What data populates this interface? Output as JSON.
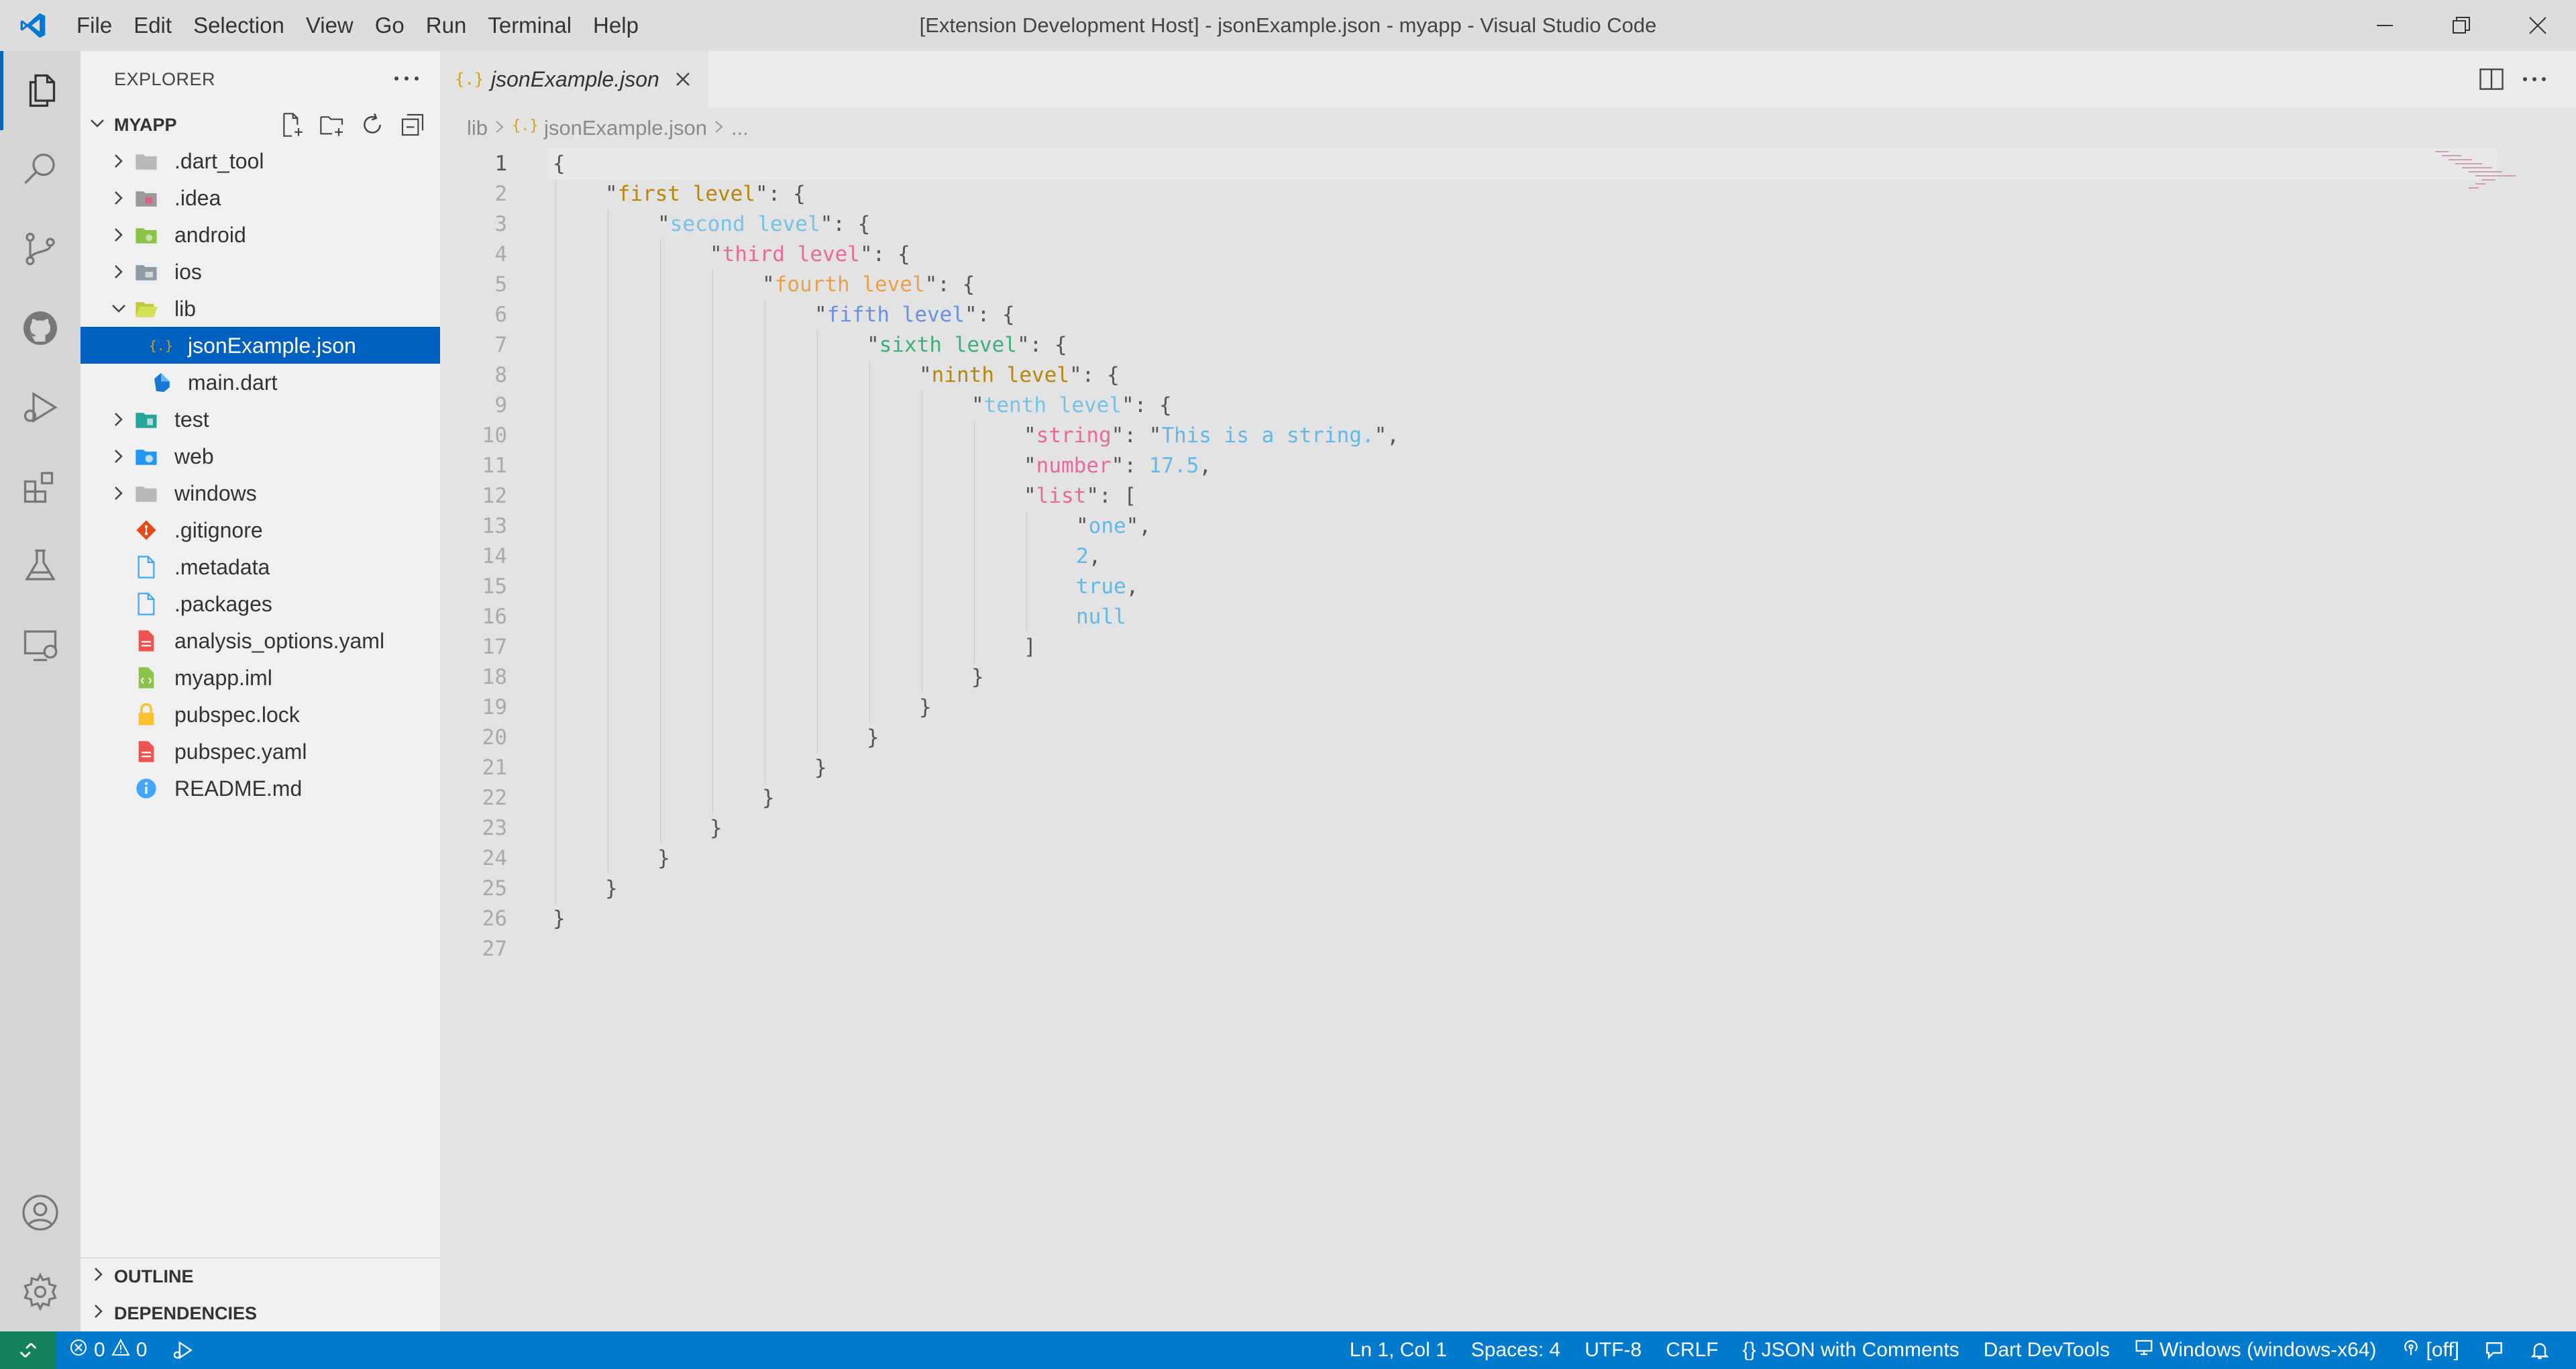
{
  "window": {
    "title": "[Extension Development Host] - jsonExample.json - myapp - Visual Studio Code"
  },
  "menu": [
    "File",
    "Edit",
    "Selection",
    "View",
    "Go",
    "Run",
    "Terminal",
    "Help"
  ],
  "activity_bar": {
    "items": [
      "explorer-icon",
      "search-icon",
      "source-control-icon",
      "github-icon",
      "run-debug-icon",
      "extensions-icon",
      "testing-icon",
      "remote-explorer-icon"
    ],
    "bottom": [
      "account-icon",
      "settings-gear-icon"
    ]
  },
  "sidebar": {
    "title": "EXPLORER",
    "root": "MYAPP",
    "tree": [
      {
        "label": ".dart_tool",
        "type": "folder",
        "icon": "folder-icon"
      },
      {
        "label": ".idea",
        "type": "folder",
        "icon": "idea-folder-icon"
      },
      {
        "label": "android",
        "type": "folder",
        "icon": "android-folder-icon"
      },
      {
        "label": "ios",
        "type": "folder",
        "icon": "ios-folder-icon"
      },
      {
        "label": "lib",
        "type": "folder-open",
        "icon": "lib-folder-icon"
      },
      {
        "label": "jsonExample.json",
        "type": "file",
        "icon": "json-file-icon",
        "selected": true
      },
      {
        "label": "main.dart",
        "type": "file",
        "icon": "dart-file-icon"
      },
      {
        "label": "test",
        "type": "folder",
        "icon": "test-folder-icon"
      },
      {
        "label": "web",
        "type": "folder",
        "icon": "web-folder-icon"
      },
      {
        "label": "windows",
        "type": "folder",
        "icon": "folder-icon"
      },
      {
        "label": ".gitignore",
        "type": "file",
        "icon": "git-file-icon"
      },
      {
        "label": ".metadata",
        "type": "file",
        "icon": "file-icon"
      },
      {
        "label": ".packages",
        "type": "file",
        "icon": "file-icon"
      },
      {
        "label": "analysis_options.yaml",
        "type": "file",
        "icon": "yaml-file-icon"
      },
      {
        "label": "myapp.iml",
        "type": "file",
        "icon": "iml-file-icon"
      },
      {
        "label": "pubspec.lock",
        "type": "file",
        "icon": "lock-file-icon"
      },
      {
        "label": "pubspec.yaml",
        "type": "file",
        "icon": "yaml-file-icon"
      },
      {
        "label": "README.md",
        "type": "file",
        "icon": "info-file-icon"
      }
    ],
    "sections": [
      "OUTLINE",
      "DEPENDENCIES"
    ]
  },
  "editor": {
    "tab_label": "jsonExample.json",
    "breadcrumb": [
      "lib",
      "jsonExample.json",
      "..."
    ],
    "colors": {
      "punct": "#555555",
      "l1": "#b8860b",
      "l2": "#74c3e6",
      "l3": "#e66b9b",
      "l4": "#e8a14a",
      "l5": "#6c8fe0",
      "l6": "#3fae7a",
      "l7": "#b8860b",
      "l8": "#74c3e6",
      "key9": "#e66b9b",
      "value": "#62b8e6"
    },
    "lines": [
      {
        "n": "1",
        "depth": 0,
        "parts": [
          [
            "{",
            "punct"
          ]
        ]
      },
      {
        "n": "2",
        "depth": 1,
        "parts": [
          [
            "\"",
            "punct"
          ],
          [
            "first level",
            "l1"
          ],
          [
            "\": {",
            "punct"
          ]
        ]
      },
      {
        "n": "3",
        "depth": 2,
        "parts": [
          [
            "\"",
            "punct"
          ],
          [
            "second level",
            "l2"
          ],
          [
            "\": {",
            "punct"
          ]
        ]
      },
      {
        "n": "4",
        "depth": 3,
        "parts": [
          [
            "\"",
            "punct"
          ],
          [
            "third level",
            "l3"
          ],
          [
            "\": {",
            "punct"
          ]
        ]
      },
      {
        "n": "5",
        "depth": 4,
        "parts": [
          [
            "\"",
            "punct"
          ],
          [
            "fourth level",
            "l4"
          ],
          [
            "\": {",
            "punct"
          ]
        ]
      },
      {
        "n": "6",
        "depth": 5,
        "parts": [
          [
            "\"",
            "punct"
          ],
          [
            "fifth level",
            "l5"
          ],
          [
            "\": {",
            "punct"
          ]
        ]
      },
      {
        "n": "7",
        "depth": 6,
        "parts": [
          [
            "\"",
            "punct"
          ],
          [
            "sixth level",
            "l6"
          ],
          [
            "\": {",
            "punct"
          ]
        ]
      },
      {
        "n": "8",
        "depth": 7,
        "parts": [
          [
            "\"",
            "punct"
          ],
          [
            "ninth level",
            "l7"
          ],
          [
            "\": {",
            "punct"
          ]
        ]
      },
      {
        "n": "9",
        "depth": 8,
        "parts": [
          [
            "\"",
            "punct"
          ],
          [
            "tenth level",
            "l8"
          ],
          [
            "\": {",
            "punct"
          ]
        ]
      },
      {
        "n": "10",
        "depth": 9,
        "parts": [
          [
            "\"",
            "punct"
          ],
          [
            "string",
            "key9"
          ],
          [
            "\": \"",
            "punct"
          ],
          [
            "This is a string.",
            "value"
          ],
          [
            "\",",
            "punct"
          ]
        ]
      },
      {
        "n": "11",
        "depth": 9,
        "parts": [
          [
            "\"",
            "punct"
          ],
          [
            "number",
            "key9"
          ],
          [
            "\": ",
            "punct"
          ],
          [
            "17.5",
            "value"
          ],
          [
            ",",
            "punct"
          ]
        ]
      },
      {
        "n": "12",
        "depth": 9,
        "parts": [
          [
            "\"",
            "punct"
          ],
          [
            "list",
            "key9"
          ],
          [
            "\": [",
            "punct"
          ]
        ]
      },
      {
        "n": "13",
        "depth": 10,
        "parts": [
          [
            "\"",
            "punct"
          ],
          [
            "one",
            "value"
          ],
          [
            "\",",
            "punct"
          ]
        ]
      },
      {
        "n": "14",
        "depth": 10,
        "parts": [
          [
            "2",
            "value"
          ],
          [
            ",",
            "punct"
          ]
        ]
      },
      {
        "n": "15",
        "depth": 10,
        "parts": [
          [
            "true",
            "value"
          ],
          [
            ",",
            "punct"
          ]
        ]
      },
      {
        "n": "16",
        "depth": 10,
        "parts": [
          [
            "null",
            "value"
          ]
        ]
      },
      {
        "n": "17",
        "depth": 9,
        "parts": [
          [
            "]",
            "punct"
          ]
        ]
      },
      {
        "n": "18",
        "depth": 8,
        "parts": [
          [
            "}",
            "punct"
          ]
        ]
      },
      {
        "n": "19",
        "depth": 7,
        "parts": [
          [
            "}",
            "punct"
          ]
        ]
      },
      {
        "n": "20",
        "depth": 6,
        "parts": [
          [
            "}",
            "punct"
          ]
        ]
      },
      {
        "n": "21",
        "depth": 5,
        "parts": [
          [
            "}",
            "punct"
          ]
        ]
      },
      {
        "n": "22",
        "depth": 4,
        "parts": [
          [
            "}",
            "punct"
          ]
        ]
      },
      {
        "n": "23",
        "depth": 3,
        "parts": [
          [
            "}",
            "punct"
          ]
        ]
      },
      {
        "n": "24",
        "depth": 2,
        "parts": [
          [
            "}",
            "punct"
          ]
        ]
      },
      {
        "n": "25",
        "depth": 1,
        "parts": [
          [
            "}",
            "punct"
          ]
        ]
      },
      {
        "n": "26",
        "depth": 0,
        "parts": [
          [
            "}",
            "punct"
          ]
        ]
      },
      {
        "n": "27",
        "depth": 0,
        "parts": []
      }
    ]
  },
  "statusbar": {
    "errors": "0",
    "warnings": "0",
    "position": "Ln 1, Col 1",
    "spaces": "Spaces: 4",
    "encoding": "UTF-8",
    "eol": "CRLF",
    "language": "JSON with Comments",
    "devtools": "Dart DevTools",
    "device": "Windows (windows-x64)",
    "live": "[off]"
  },
  "theme": {
    "accent": "#007acc",
    "selection": "#0060c0",
    "remote": "#16825d"
  }
}
